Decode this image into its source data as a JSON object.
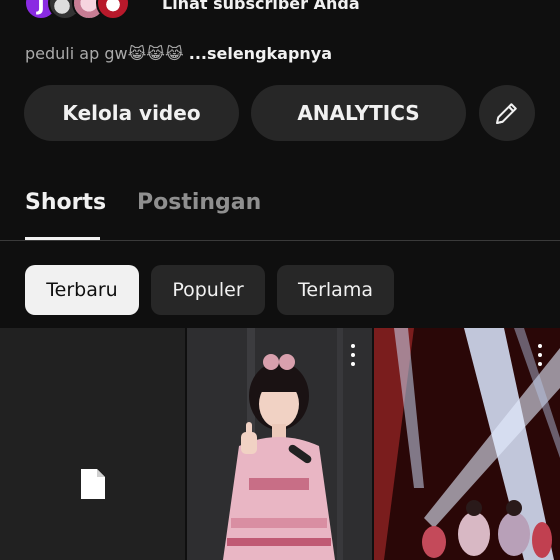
{
  "subscribers": {
    "avatar_initial": "J",
    "link_label": "Lihat subscriber Anda"
  },
  "description": {
    "text": "peduli ap gw😹😹😹 ",
    "more_label": "...selengkapnya"
  },
  "actions": {
    "manage_label": "Kelola video",
    "analytics_label": "ANALYTICS",
    "edit_icon": "pencil-icon"
  },
  "tabs": [
    {
      "label": "Shorts",
      "active": true
    },
    {
      "label": "Postingan",
      "active": false
    }
  ],
  "filters": [
    {
      "label": "Terbaru",
      "selected": true
    },
    {
      "label": "Populer",
      "selected": false
    },
    {
      "label": "Terlama",
      "selected": false
    }
  ],
  "grid": {
    "items": [
      {
        "thumbnail": "file-placeholder-icon"
      },
      {
        "thumbnail": "idol-performer-photo",
        "menu_icon": "more-vert-icon"
      },
      {
        "thumbnail": "stage-lights-performance-photo",
        "menu_icon": "more-vert-icon"
      }
    ]
  },
  "colors": {
    "background": "#0f0f0f",
    "button_bg": "#272727",
    "text": "#f1f1f1",
    "muted_text": "#aaaaaa",
    "active_chip_bg": "#f1f1f1"
  }
}
